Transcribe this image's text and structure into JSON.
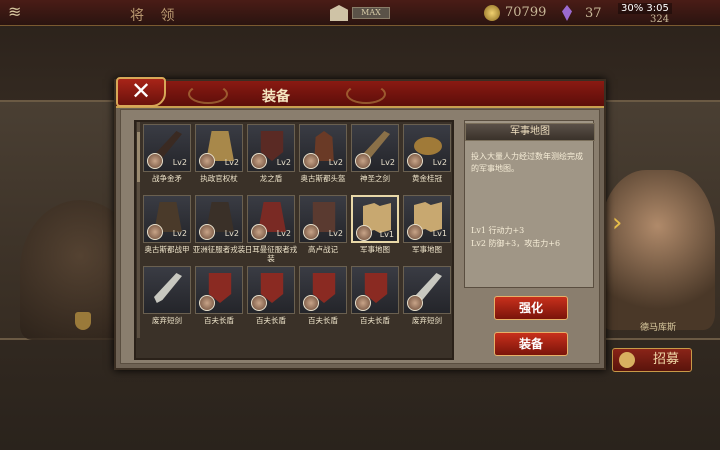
{
  "topbar": {
    "title": "将 领",
    "max_label": "MAX",
    "coins": "70799",
    "gems": "37",
    "food": "324",
    "status": "30% 3:05"
  },
  "background": {
    "general_name": "德马库斯"
  },
  "recruit_label": "招募",
  "modal": {
    "title": "装备",
    "close_label": "✕"
  },
  "items": [
    {
      "name": "战争金矛",
      "lv": "Lv2",
      "icon": "spear-icon",
      "color": "#3a2a22"
    },
    {
      "name": "执政官权杖",
      "lv": "Lv2",
      "icon": "scepter-icon",
      "color": "#a8884a"
    },
    {
      "name": "龙之盾",
      "lv": "Lv2",
      "icon": "shield-icon",
      "color": "#5a2a24"
    },
    {
      "name": "奥古斯都头盔",
      "lv": "Lv2",
      "icon": "helmet-icon",
      "color": "#6a3a26"
    },
    {
      "name": "神圣之剑",
      "lv": "Lv2",
      "icon": "sword-icon",
      "color": "#8a7048"
    },
    {
      "name": "黄金桂冠",
      "lv": "Lv2",
      "icon": "laurel-icon",
      "color": "#a07a38"
    },
    {
      "name": "奥古斯都战甲",
      "lv": "Lv2",
      "icon": "armor-icon",
      "color": "#4a3a2a"
    },
    {
      "name": "亚洲征服者戎装",
      "lv": "Lv2",
      "icon": "armor-icon",
      "color": "#3a3028"
    },
    {
      "name": "日耳曼征服者戎装",
      "lv": "Lv2",
      "icon": "armor-icon",
      "color": "#7a2a24"
    },
    {
      "name": "高卢战记",
      "lv": "Lv2",
      "icon": "book-icon",
      "color": "#5a3a30"
    },
    {
      "name": "军事地图",
      "lv": "Lv1",
      "icon": "map-icon",
      "color": "#c8a870"
    },
    {
      "name": "军事地图",
      "lv": "Lv1",
      "icon": "map-icon",
      "color": "#c8a870"
    },
    {
      "name": "废弃短剑",
      "lv": "",
      "icon": "dagger-icon",
      "color": "#c8c8c0"
    },
    {
      "name": "百夫长盾",
      "lv": "",
      "icon": "shield-icon",
      "color": "#8a2a22"
    },
    {
      "name": "百夫长盾",
      "lv": "",
      "icon": "shield-icon",
      "color": "#8a2a22"
    },
    {
      "name": "百夫长盾",
      "lv": "",
      "icon": "shield-icon",
      "color": "#8a2a22"
    },
    {
      "name": "百夫长盾",
      "lv": "",
      "icon": "shield-icon",
      "color": "#8a2a22"
    },
    {
      "name": "废弃短剑",
      "lv": "",
      "icon": "dagger-icon",
      "color": "#c8c8c0"
    }
  ],
  "detail": {
    "title": "军事地图",
    "description": "投入大量人力经过数年测绘完成的军事地图。",
    "stat1": "Lv1 行动力+3",
    "stat2": "Lv2 防御+3，攻击力+6"
  },
  "buttons": {
    "upgrade": "强化",
    "equip": "装备"
  }
}
